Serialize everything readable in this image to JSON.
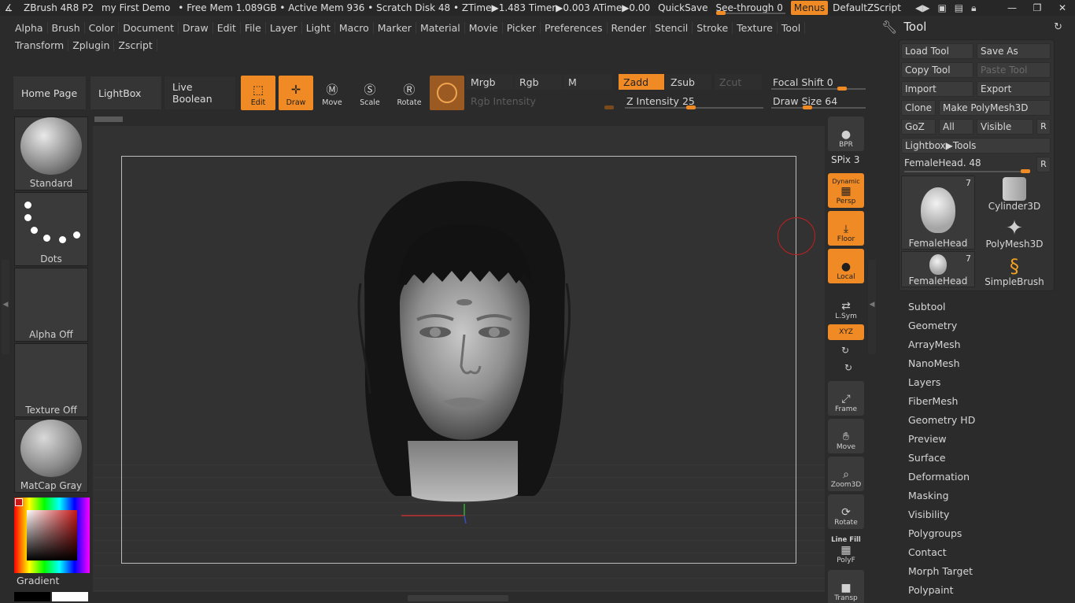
{
  "titlebar": {
    "app": "ZBrush 4R8 P2",
    "doc": "my First Demo",
    "stats": "• Free Mem 1.089GB • Active Mem 936 • Scratch Disk 48 • ZTime▶1.483 Timer▶0.003 ATime▶0.00",
    "quicksave": "QuickSave",
    "see_through": "See-through",
    "see_through_value": "0",
    "menus": "Menus",
    "default_zscript": "DefaultZScript"
  },
  "menu": {
    "row1": [
      "Alpha",
      "Brush",
      "Color",
      "Document",
      "Draw",
      "Edit",
      "File",
      "Layer",
      "Light",
      "Macro",
      "Marker",
      "Material",
      "Movie",
      "Picker",
      "Preferences",
      "Render",
      "Stencil",
      "Stroke",
      "Texture",
      "Tool"
    ],
    "row2": [
      "Transform",
      "Zplugin",
      "Zscript"
    ]
  },
  "shelf": {
    "home_page": "Home Page",
    "lightbox": "LightBox",
    "live_boolean": "Live Boolean",
    "edit": "Edit",
    "draw": "Draw",
    "move": "Move",
    "scale": "Scale",
    "rotate": "Rotate",
    "mrgb": "Mrgb",
    "rgb": "Rgb",
    "m": "M",
    "zadd": "Zadd",
    "zsub": "Zsub",
    "zcut": "Zcut",
    "rgb_intensity": "Rgb Intensity",
    "z_intensity": "Z Intensity",
    "z_intensity_value": "25",
    "focal_shift": "Focal Shift",
    "focal_shift_value": "0",
    "draw_size": "Draw Size",
    "draw_size_value": "64"
  },
  "left_tray": {
    "brush": "Standard",
    "stroke": "Dots",
    "alpha": "Alpha Off",
    "texture": "Texture Off",
    "material": "MatCap Gray",
    "gradient": "Gradient"
  },
  "view_tray": {
    "bpr": "BPR",
    "spix": "SPix 3",
    "dynamic": "Dynamic",
    "persp": "Persp",
    "floor": "Floor",
    "local": "Local",
    "lsym": "L.Sym",
    "xyz": "XYZ",
    "frame": "Frame",
    "move": "Move",
    "zoom3d": "Zoom3D",
    "rotate": "Rotate",
    "line_fill": "Line Fill",
    "polyf": "PolyF",
    "transp": "Transp"
  },
  "tool_panel": {
    "title": "Tool",
    "load_tool": "Load Tool",
    "save_as": "Save As",
    "copy_tool": "Copy Tool",
    "paste_tool": "Paste Tool",
    "import": "Import",
    "export": "Export",
    "clone": "Clone",
    "make_polymesh": "Make PolyMesh3D",
    "goz": "GoZ",
    "all": "All",
    "visible": "Visible",
    "r": "R",
    "lightbox_tools": "Lightbox▶Tools",
    "current_tool": "FemaleHead.",
    "current_tool_value": "48",
    "tiles": [
      {
        "name": "FemaleHead",
        "count": "7"
      },
      {
        "name": "Cylinder3D",
        "count": ""
      },
      {
        "name": "PolyMesh3D",
        "count": ""
      },
      {
        "name": "FemaleHead",
        "count": "7"
      },
      {
        "name": "SimpleBrush",
        "count": ""
      }
    ],
    "subpalettes": [
      "Subtool",
      "Geometry",
      "ArrayMesh",
      "NanoMesh",
      "Layers",
      "FiberMesh",
      "Geometry HD",
      "Preview",
      "Surface",
      "Deformation",
      "Masking",
      "Visibility",
      "Polygroups",
      "Contact",
      "Morph Target",
      "Polypaint"
    ]
  }
}
